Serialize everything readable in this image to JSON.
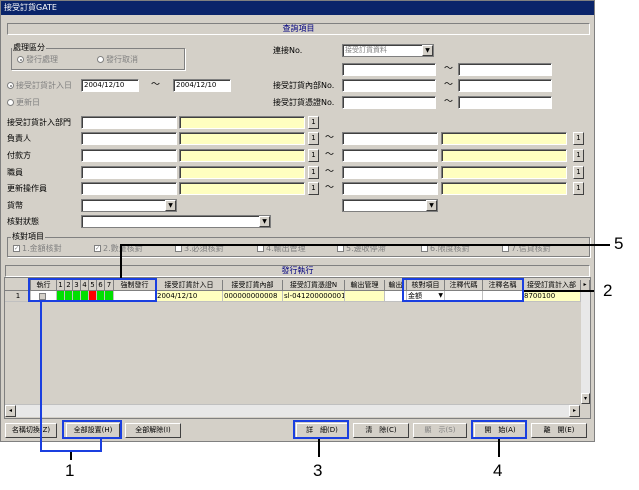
{
  "window": {
    "title": "接受訂貨GATE"
  },
  "query": {
    "title": "查詢項目",
    "proc": {
      "label": "處理區分",
      "opt1": "發行處理",
      "opt2": "發行取消"
    },
    "recv_label": "接受訂貨計入日",
    "recv_from": "2004/12/10",
    "recv_to": "2004/12/10",
    "update_label": "更新日",
    "link_label": "連接No.",
    "link_value": "接受訂貨資料",
    "internal_label": "接受訂貨內部No.",
    "slip_label": "接受訂貨憑證No.",
    "dept_label": "接受訂貨計入部門",
    "person_label": "負責人",
    "payer_label": "付款方",
    "staff_label": "職員",
    "updater_label": "更新操作員",
    "currency_label": "貨幣",
    "status_label": "核對狀態",
    "tilde": "～",
    "btn1": "1"
  },
  "checks": {
    "title": "核對項目",
    "items": [
      "1.金額核對",
      "2.數量核對",
      "3.必須核對",
      "4.輸出管理",
      "5.邊收停滯",
      "6.限度核對",
      "7.信貸核對"
    ]
  },
  "grid": {
    "title": "發行執行",
    "headers": [
      "執行",
      "1",
      "2",
      "3",
      "4",
      "5",
      "6",
      "7",
      "強制發行",
      "接受訂貨計入日",
      "接受訂貨內部",
      "接受訂貨憑證N",
      "輸出管理",
      "輸出",
      "核對項目",
      "注釋代碼",
      "注釋名稱",
      "接受訂貨計入部"
    ],
    "row": {
      "num": "1",
      "date": "2004/12/10",
      "internal": "000000000008",
      "slip": "sl-041200000001",
      "check_item": "金額",
      "dept": "8700100"
    }
  },
  "buttons": {
    "switch": "名稱切換(Z)",
    "set_all": "全部設置(H)",
    "clear_all": "全部解除(I)",
    "detail": "詳　細(D)",
    "delete": "清　除(C)",
    "display": "顯　示(S)",
    "start": "開　始(A)",
    "close": "離　開(E)"
  },
  "callouts": {
    "c1": "1",
    "c2": "2",
    "c3": "3",
    "c4": "4",
    "c5": "5"
  },
  "colors": {
    "highlight": "#1a3fe0",
    "green": "#00e000",
    "red": "#ff0000",
    "title": "#0a246a"
  }
}
